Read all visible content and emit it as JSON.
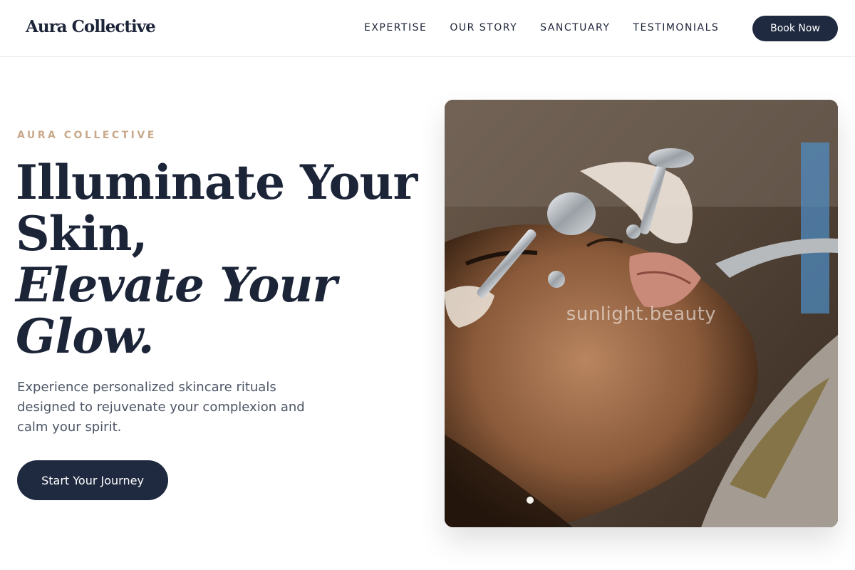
{
  "brand": {
    "name": "Aura Collective"
  },
  "nav": {
    "links": [
      "EXPERTISE",
      "OUR STORY",
      "SANCTUARY",
      "TESTIMONIALS"
    ],
    "cta_label": "Book Now"
  },
  "hero": {
    "eyebrow": "AURA COLLECTIVE",
    "headline_line1": "Illuminate Your",
    "headline_line2": "Skin,",
    "headline_line3": "Elevate Your",
    "headline_line4": "Glow.",
    "subtext": "Experience personalized skincare rituals designed to rejuvenate your complexion and calm your spirit.",
    "cta_label": "Start Your Journey",
    "image": {
      "watermark": "sunlight.beauty"
    }
  },
  "colors": {
    "navy": "#1f2a40",
    "accent_gold": "#c9a98b",
    "body_text": "#4d5566"
  }
}
